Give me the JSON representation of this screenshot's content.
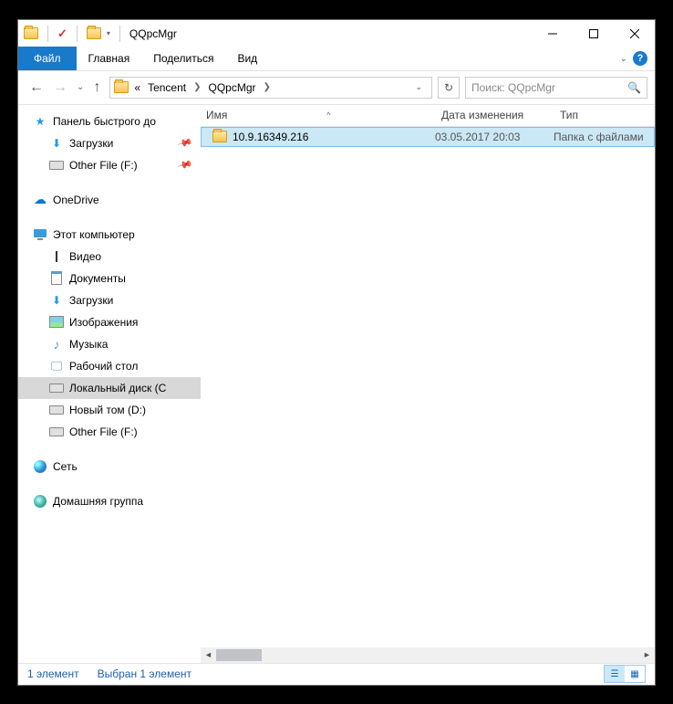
{
  "title": "QQpcMgr",
  "ribbon": {
    "file": "Файл",
    "home": "Главная",
    "share": "Поделиться",
    "view": "Вид"
  },
  "breadcrumbs": {
    "prefix": "«",
    "seg1": "Tencent",
    "seg2": "QQpcMgr"
  },
  "search_placeholder": "Поиск: QQpcMgr",
  "columns": {
    "name": "Имя",
    "date": "Дата изменения",
    "type": "Тип"
  },
  "file": {
    "name": "10.9.16349.216",
    "date": "03.05.2017 20:03",
    "type": "Папка с файлами"
  },
  "nav": {
    "quick": "Панель быстрого до",
    "downloads": "Загрузки",
    "otherf": "Other File (F:)",
    "onedrive": "OneDrive",
    "thispc": "Этот компьютер",
    "video": "Видео",
    "documents": "Документы",
    "downloads2": "Загрузки",
    "pictures": "Изображения",
    "music": "Музыка",
    "desktop": "Рабочий стол",
    "localc": "Локальный диск (C",
    "vold": "Новый том (D:)",
    "otherf2": "Other File (F:)",
    "network": "Сеть",
    "homegroup": "Домашняя группа"
  },
  "status": {
    "count": "1 элемент",
    "selected": "Выбран 1 элемент"
  }
}
